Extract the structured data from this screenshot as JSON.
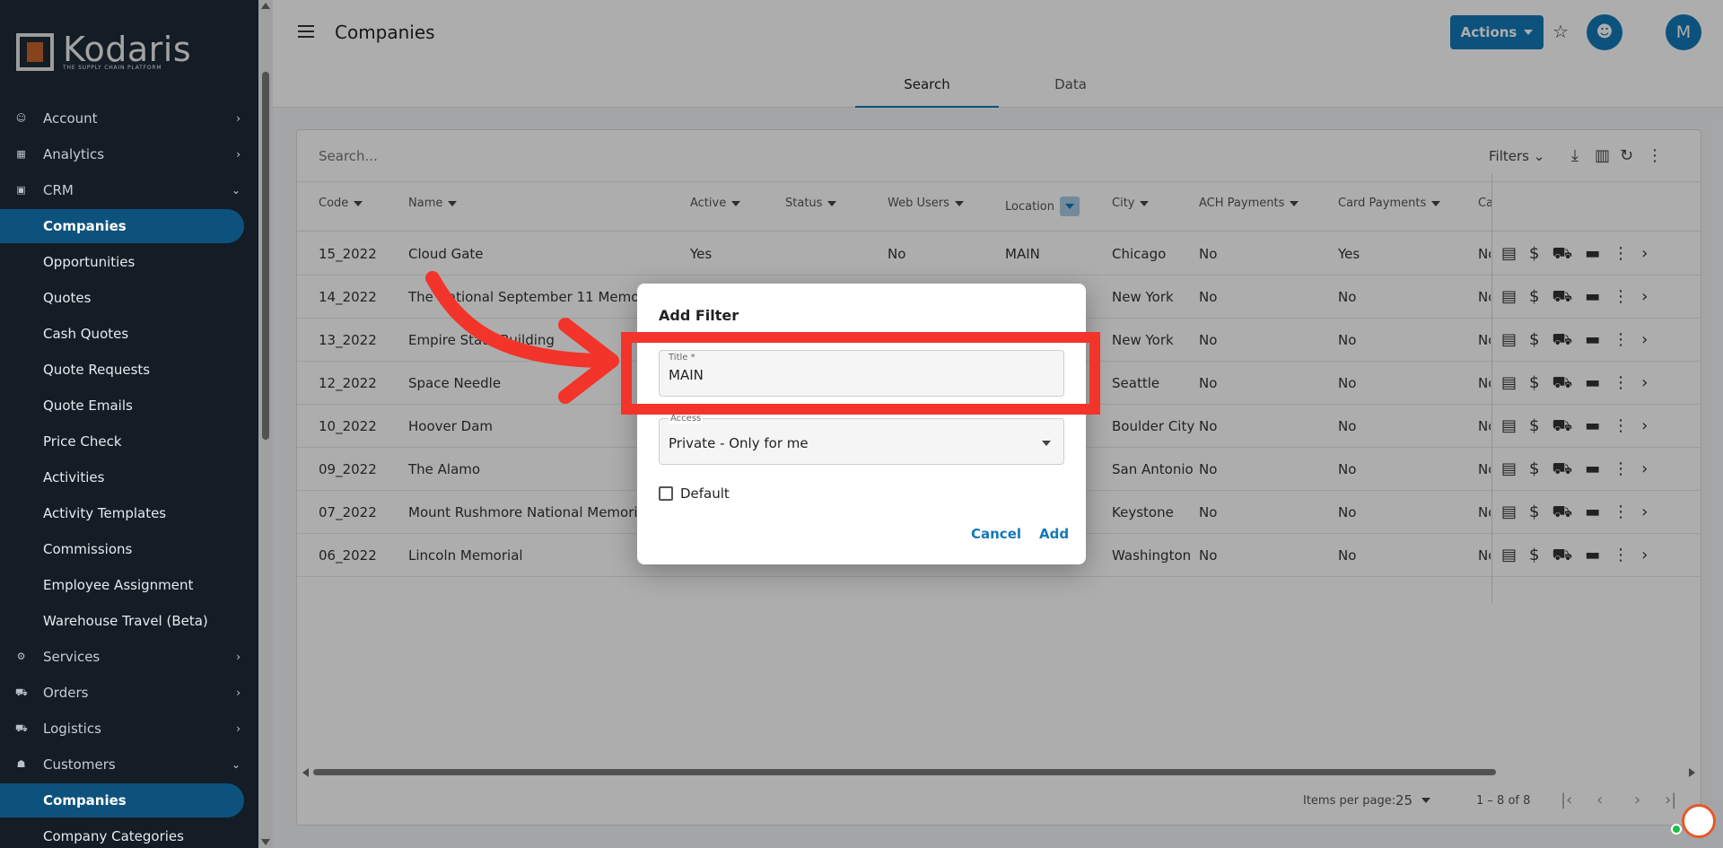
{
  "app": {
    "logo_text": "Kodaris",
    "logo_tagline": "THE SUPPLY CHAIN PLATFORM"
  },
  "sidebar": {
    "items": [
      {
        "label": "Account",
        "kind": "top",
        "icon": "account-icon",
        "chevron": "right"
      },
      {
        "label": "Analytics",
        "kind": "top",
        "icon": "analytics-icon",
        "chevron": "right"
      },
      {
        "label": "CRM",
        "kind": "top",
        "icon": "crm-icon",
        "chevron": "down"
      },
      {
        "label": "Companies",
        "kind": "sub",
        "active": true
      },
      {
        "label": "Opportunities",
        "kind": "sub"
      },
      {
        "label": "Quotes",
        "kind": "sub"
      },
      {
        "label": "Cash Quotes",
        "kind": "sub"
      },
      {
        "label": "Quote Requests",
        "kind": "sub"
      },
      {
        "label": "Quote Emails",
        "kind": "sub"
      },
      {
        "label": "Price Check",
        "kind": "sub"
      },
      {
        "label": "Activities",
        "kind": "sub"
      },
      {
        "label": "Activity Templates",
        "kind": "sub"
      },
      {
        "label": "Commissions",
        "kind": "sub"
      },
      {
        "label": "Employee Assignment",
        "kind": "sub"
      },
      {
        "label": "Warehouse Travel (Beta)",
        "kind": "sub"
      },
      {
        "label": "Services",
        "kind": "top",
        "icon": "services-icon",
        "chevron": "right"
      },
      {
        "label": "Orders",
        "kind": "top",
        "icon": "orders-icon",
        "chevron": "right"
      },
      {
        "label": "Logistics",
        "kind": "top",
        "icon": "logistics-icon",
        "chevron": "right"
      },
      {
        "label": "Customers",
        "kind": "top",
        "icon": "customers-icon",
        "chevron": "down"
      },
      {
        "label": "Companies",
        "kind": "sub",
        "active": true
      },
      {
        "label": "Company Categories",
        "kind": "sub"
      }
    ]
  },
  "header": {
    "title": "Companies",
    "actions_label": "Actions",
    "avatar_initial": "M"
  },
  "tabs": [
    {
      "label": "Search",
      "selected": true
    },
    {
      "label": "Data",
      "selected": false
    }
  ],
  "grid": {
    "search_placeholder": "Search...",
    "filters_label": "Filters",
    "columns": [
      {
        "label": "Code"
      },
      {
        "label": "Name"
      },
      {
        "label": "Active"
      },
      {
        "label": "Status"
      },
      {
        "label": "Web Users"
      },
      {
        "label": "Location"
      },
      {
        "label": "City"
      },
      {
        "label": "ACH Payments"
      },
      {
        "label": "Card Payments"
      },
      {
        "label": "Ca"
      }
    ],
    "rows": [
      {
        "code": "15_2022",
        "name": "Cloud Gate",
        "active": "Yes",
        "web_users": "No",
        "location": "MAIN",
        "city": "Chicago",
        "ach": "No",
        "card": "Yes",
        "ca": "No"
      },
      {
        "code": "14_2022",
        "name": "The National September 11 Memorial Mu",
        "active": "",
        "web_users": "",
        "location": "",
        "city": "New York",
        "ach": "No",
        "card": "No",
        "ca": "No"
      },
      {
        "code": "13_2022",
        "name": "Empire State Building",
        "active": "",
        "web_users": "",
        "location": "",
        "city": "New York",
        "ach": "No",
        "card": "No",
        "ca": "No"
      },
      {
        "code": "12_2022",
        "name": "Space Needle",
        "active": "",
        "web_users": "",
        "location": "",
        "city": "Seattle",
        "ach": "No",
        "card": "No",
        "ca": "No"
      },
      {
        "code": "10_2022",
        "name": "Hoover Dam",
        "active": "",
        "web_users": "",
        "location": "",
        "city": "Boulder City",
        "ach": "No",
        "card": "No",
        "ca": "No"
      },
      {
        "code": "09_2022",
        "name": "The Alamo",
        "active": "",
        "web_users": "",
        "location": "",
        "city": "San Antonio",
        "ach": "No",
        "card": "No",
        "ca": "No"
      },
      {
        "code": "07_2022",
        "name": "Mount Rushmore National Memorial",
        "active": "",
        "web_users": "",
        "location": "",
        "city": "Keystone",
        "ach": "No",
        "card": "No",
        "ca": "No"
      },
      {
        "code": "06_2022",
        "name": "Lincoln Memorial",
        "active": "",
        "web_users": "",
        "location": "",
        "city": "Washington",
        "ach": "No",
        "card": "No",
        "ca": "No"
      }
    ],
    "items_per_page_label": "Items per page:",
    "items_per_page_value": "25",
    "range_label": "1 – 8 of 8"
  },
  "dialog": {
    "title": "Add Filter",
    "title_field_label": "Title *",
    "title_field_value": "MAIN",
    "access_field_label": "Access",
    "access_field_value": "Private - Only for me",
    "default_label": "Default",
    "default_checked": false,
    "cancel_label": "Cancel",
    "add_label": "Add"
  },
  "colors": {
    "accent": "#1479b8",
    "sidebar_bg": "#1e2a38",
    "highlight": "#f2342a"
  }
}
